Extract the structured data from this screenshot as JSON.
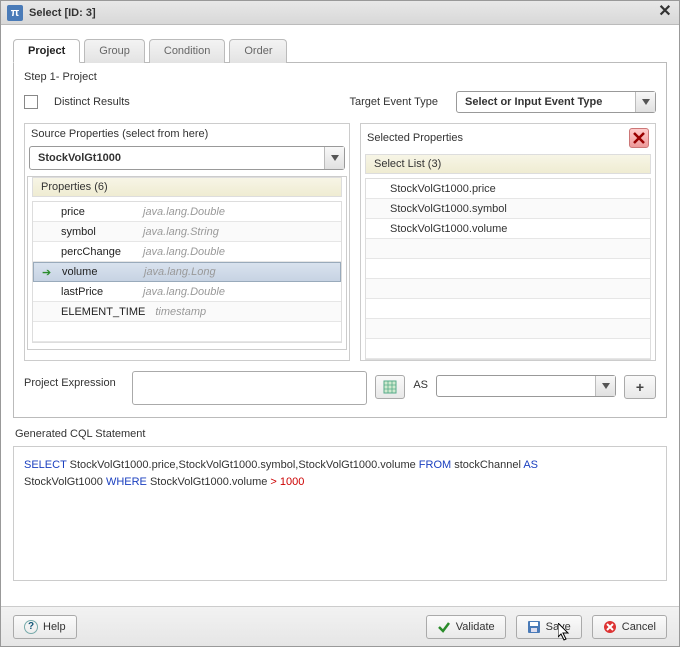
{
  "dialog": {
    "title": "Select [ID: 3]"
  },
  "tabs": {
    "project": "Project",
    "group": "Group",
    "condition": "Condition",
    "order": "Order"
  },
  "step": "Step 1- Project",
  "distinct_label": "Distinct Results",
  "target_event_type_label": "Target Event Type",
  "target_event_type_value": "Select or Input Event Type",
  "source_pane": {
    "title": "Source Properties (select from here)",
    "stream": "StockVolGt1000",
    "properties_header": "Properties (6)",
    "items": [
      {
        "name": "price",
        "type": "java.lang.Double"
      },
      {
        "name": "symbol",
        "type": "java.lang.String"
      },
      {
        "name": "percChange",
        "type": "java.lang.Double"
      },
      {
        "name": "volume",
        "type": "java.lang.Long"
      },
      {
        "name": "lastPrice",
        "type": "java.lang.Double"
      },
      {
        "name": "ELEMENT_TIME",
        "type": "timestamp"
      }
    ],
    "selected_index": 3
  },
  "selected_pane": {
    "title": "Selected Properties",
    "list_header": "Select List (3)",
    "items": [
      "StockVolGt1000.price",
      "StockVolGt1000.symbol",
      "StockVolGt1000.volume"
    ]
  },
  "proj_expr": {
    "label": "Project Expression",
    "as_label": "AS",
    "as_value": "",
    "plus": "+"
  },
  "gen": {
    "label": "Generated CQL Statement",
    "tokens": {
      "select": "SELECT",
      "cols": " StockVolGt1000.price,StockVolGt1000.symbol,StockVolGt1000.volume ",
      "from": "FROM",
      "stream": " stockChannel ",
      "as": "AS",
      "alias": " StockVolGt1000 ",
      "where": "WHERE",
      "cond": " StockVolGt1000.volume ",
      "op": ">",
      "val": " 1000"
    }
  },
  "footer": {
    "help": "Help",
    "validate": "Validate",
    "save": "Save",
    "cancel": "Cancel"
  }
}
